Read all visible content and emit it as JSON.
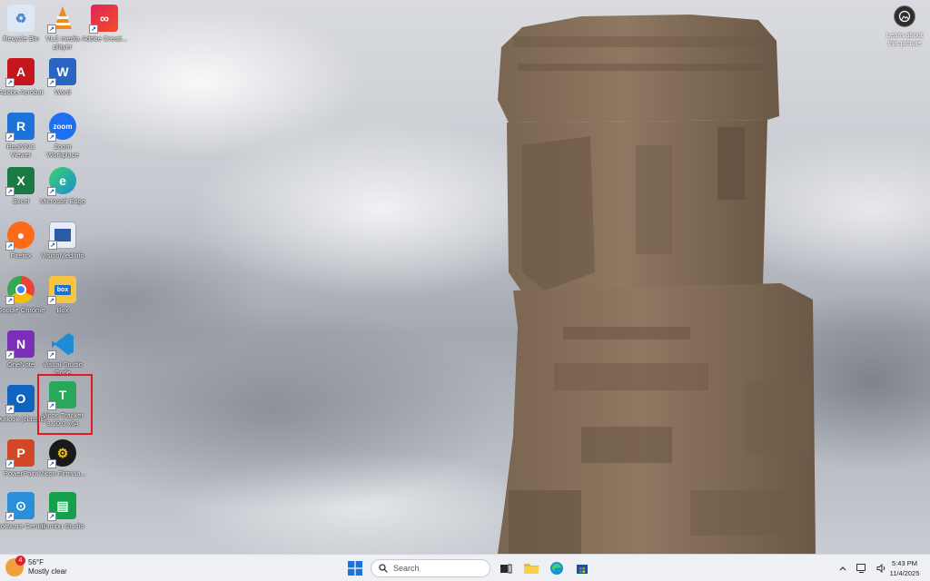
{
  "desktop": {
    "icons": [
      {
        "label": "Recycle Bin",
        "icon": "recycle-bin-icon",
        "color": "#6fa0d8"
      },
      {
        "label": "VLC media player",
        "icon": "vlc-icon",
        "color": "#f08a1c"
      },
      {
        "label": "Adobe Creati...",
        "icon": "adobe-creative-cloud-icon",
        "color": "#e0245e"
      },
      {
        "label": "Adobe Acrobat",
        "icon": "adobe-acrobat-icon",
        "color": "#c5161d"
      },
      {
        "label": "Word",
        "icon": "word-icon",
        "color": "#2b65c2"
      },
      {
        "label": "RealVNC Viewer",
        "icon": "realvnc-icon",
        "color": "#1e73d8"
      },
      {
        "label": "Zoom Workplace",
        "icon": "zoom-icon",
        "color": "#1f6ff2"
      },
      {
        "label": "Excel",
        "icon": "excel-icon",
        "color": "#1b7a43"
      },
      {
        "label": "Microsoft Edge",
        "icon": "edge-icon",
        "color": "#1a8fd6"
      },
      {
        "label": "Firefox",
        "icon": "firefox-icon",
        "color": "#ff6a1a"
      },
      {
        "label": "VisionMedInfo",
        "icon": "document-icon",
        "color": "#e8edf5"
      },
      {
        "label": "Google Chrome",
        "icon": "chrome-icon",
        "color": "#ea4335"
      },
      {
        "label": "Box",
        "icon": "box-icon",
        "color": "#1b6fd4"
      },
      {
        "label": "OneNote",
        "icon": "onenote-icon",
        "color": "#7b2fb8"
      },
      {
        "label": "Visual Studio Code",
        "icon": "vscode-icon",
        "color": "#1f8ad6"
      },
      {
        "label": "Outlook (classic)",
        "icon": "outlook-icon",
        "color": "#0f64c2"
      },
      {
        "label": "Vicon Tracker 3.10.0 x64",
        "icon": "vicon-tracker-icon",
        "color": "#2aa85a"
      },
      {
        "label": "PowerPoint",
        "icon": "powerpoint-icon",
        "color": "#d24726"
      },
      {
        "label": "Vicon Firmwa...",
        "icon": "vicon-firmware-icon",
        "color": "#1a1a1a"
      },
      {
        "label": "Software Center",
        "icon": "software-center-icon",
        "color": "#2a8fd8"
      },
      {
        "label": "Bambu Studio",
        "icon": "bambu-studio-icon",
        "color": "#13a04a"
      }
    ],
    "learn_label": "Learn about this picture"
  },
  "taskbar": {
    "weather_temp": "56°F",
    "weather_desc": "Mostly clear",
    "weather_badge": "4",
    "search_placeholder": "Search",
    "time": "5:43 PM",
    "date": "11/4/2025"
  }
}
